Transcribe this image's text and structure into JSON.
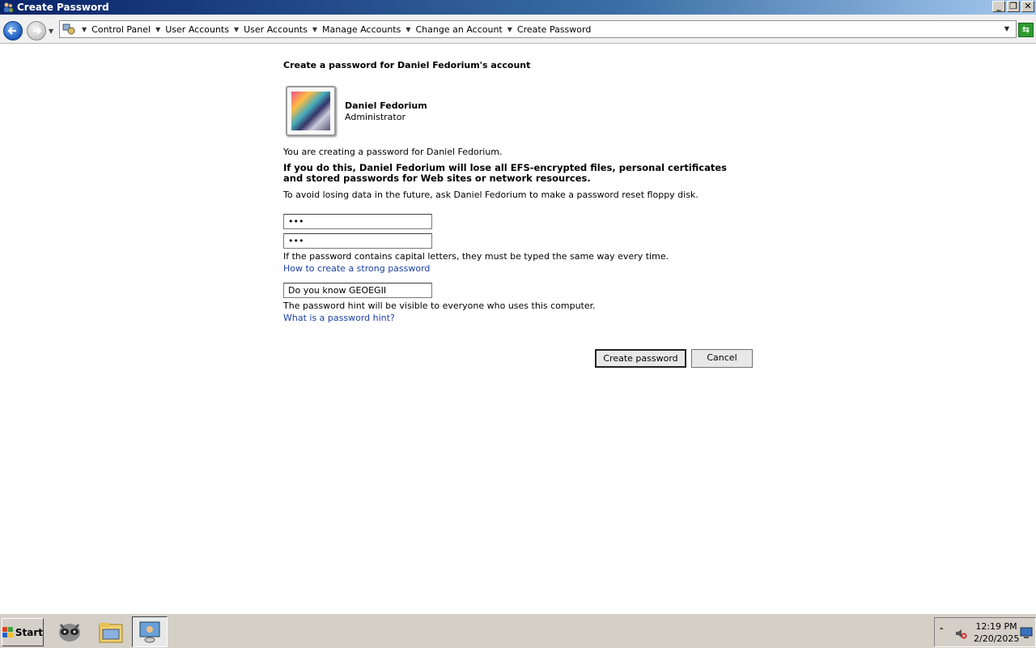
{
  "window": {
    "title": "Create Password"
  },
  "address": {
    "crumbs": [
      "Control Panel",
      "User Accounts",
      "User Accounts",
      "Manage Accounts",
      "Change an Account",
      "Create Password"
    ]
  },
  "content": {
    "heading": "Create a password for Daniel Fedorium's account",
    "user_name": "Daniel Fedorium",
    "user_role": "Administrator",
    "intro": "You are creating a password for Daniel Fedorium.",
    "warning": "If you do this, Daniel Fedorium will lose all EFS-encrypted files, personal certificates and stored passwords for Web sites or network resources.",
    "advice": "To avoid losing data in the future, ask Daniel Fedorium to make a password reset floppy disk.",
    "password_value": "•••",
    "confirm_value": "•••",
    "caps_note": "If the password contains capital letters, they must be typed the same way every time.",
    "strong_link": "How to create a strong password",
    "hint_value": "Do you know GEOEGII",
    "hint_note": "The password hint will be visible to everyone who uses this computer.",
    "hint_link": "What is a password hint?",
    "create_button": "Create password",
    "cancel_button": "Cancel"
  },
  "taskbar": {
    "start_label": "Start",
    "time": "12:19 PM",
    "date": "2/20/2025"
  },
  "colors": {
    "link": "#1a3ea5",
    "titlebar": "#0a246a"
  }
}
